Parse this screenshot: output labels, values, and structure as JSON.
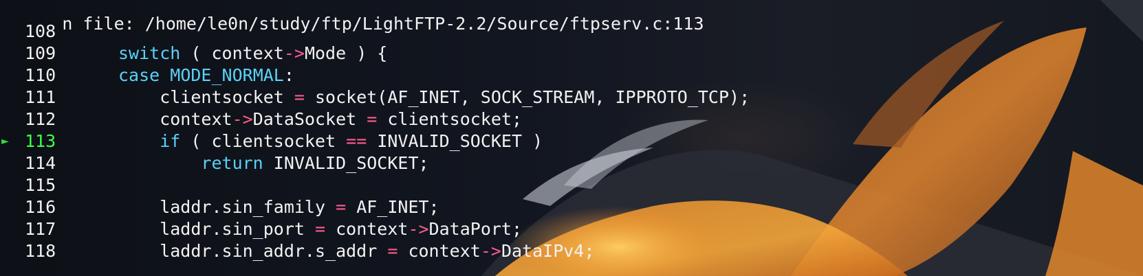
{
  "header": {
    "text": "n file: /home/le0n/study/ftp/LightFTP-2.2/Source/ftpserv.c:113"
  },
  "current_line_marker": "►",
  "lines": [
    {
      "num": "108",
      "src": []
    },
    {
      "num": "109",
      "src": [
        [
          "kw",
          "switch"
        ],
        [
          "plain",
          " ( context"
        ],
        [
          "op",
          "->"
        ],
        [
          "plain",
          "Mode ) {"
        ]
      ]
    },
    {
      "num": "110",
      "src": [
        [
          "kw",
          "case"
        ],
        [
          "plain",
          " "
        ],
        [
          "kw",
          "MODE_NORMAL"
        ],
        [
          "plain",
          ":"
        ]
      ]
    },
    {
      "num": "111",
      "src": [
        [
          "plain",
          "    clientsocket "
        ],
        [
          "op",
          "="
        ],
        [
          "plain",
          " socket(AF_INET, SOCK_STREAM, IPPROTO_TCP);"
        ]
      ]
    },
    {
      "num": "112",
      "src": [
        [
          "plain",
          "    context"
        ],
        [
          "op",
          "->"
        ],
        [
          "plain",
          "DataSocket "
        ],
        [
          "op",
          "="
        ],
        [
          "plain",
          " clientsocket;"
        ]
      ]
    },
    {
      "num": "113",
      "current": true,
      "src": [
        [
          "plain",
          "    "
        ],
        [
          "kw",
          "if"
        ],
        [
          "plain",
          " ( clientsocket "
        ],
        [
          "op",
          "=="
        ],
        [
          "plain",
          " INVALID_SOCKET )"
        ]
      ]
    },
    {
      "num": "114",
      "src": [
        [
          "plain",
          "        "
        ],
        [
          "kw",
          "return"
        ],
        [
          "plain",
          " INVALID_SOCKET;"
        ]
      ]
    },
    {
      "num": "115",
      "src": []
    },
    {
      "num": "116",
      "src": [
        [
          "plain",
          "    laddr.sin_family "
        ],
        [
          "op",
          "="
        ],
        [
          "plain",
          " AF_INET;"
        ]
      ]
    },
    {
      "num": "117",
      "src": [
        [
          "plain",
          "    laddr.sin_port "
        ],
        [
          "op",
          "="
        ],
        [
          "plain",
          " context"
        ],
        [
          "op",
          "->"
        ],
        [
          "plain",
          "DataPort;"
        ]
      ]
    },
    {
      "num": "118",
      "src": [
        [
          "plain",
          "    laddr.sin_addr.s_addr "
        ],
        [
          "op",
          "="
        ],
        [
          "plain",
          " context"
        ],
        [
          "op",
          "->"
        ],
        [
          "plain",
          "DataIPv4;"
        ]
      ]
    }
  ],
  "colors": {
    "keyword": "#5ad1f7",
    "operator": "#ff5c8d",
    "text": "#f2f2f2",
    "current_line": "#3cff4a",
    "marker": "#2fdd3c"
  }
}
